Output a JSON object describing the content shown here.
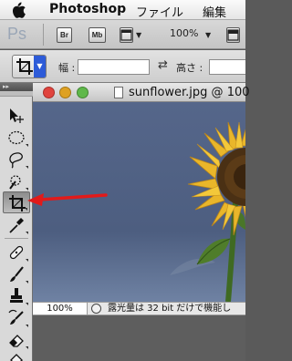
{
  "menubar": {
    "app_name": "Photoshop",
    "menus": [
      "ファイル",
      "編集"
    ]
  },
  "appbar": {
    "logo": "Ps",
    "bridge_label": "Br",
    "minibridge_label": "Mb",
    "zoom_value": "100%"
  },
  "options": {
    "width_label": "幅 :",
    "height_label": "高さ :",
    "width_value": "",
    "height_value": ""
  },
  "tools": [
    {
      "name": "move-tool",
      "icon": "move-icon"
    },
    {
      "name": "marquee-tool",
      "icon": "ellipse-marquee-icon"
    },
    {
      "name": "lasso-tool",
      "icon": "lasso-icon"
    },
    {
      "name": "quick-selection-tool",
      "icon": "quick-selection-icon"
    },
    {
      "name": "crop-tool",
      "icon": "crop-icon",
      "active": true
    },
    {
      "name": "eyedropper-tool",
      "icon": "eyedropper-icon"
    },
    {
      "name": "healing-brush-tool",
      "icon": "bandage-icon"
    },
    {
      "name": "brush-tool",
      "icon": "brush-icon"
    },
    {
      "name": "clone-stamp-tool",
      "icon": "stamp-icon"
    },
    {
      "name": "history-brush-tool",
      "icon": "history-brush-icon"
    },
    {
      "name": "eraser-tool",
      "icon": "eraser-icon"
    },
    {
      "name": "paint-bucket-tool",
      "icon": "paint-bucket-icon"
    }
  ],
  "document": {
    "title": "sunflower.jpg @ 100",
    "status_zoom": "100%",
    "status_info": "露光量は 32 bit だけで機能し"
  },
  "colors": {
    "accent": "#2d5bd8",
    "close": "#e0443e",
    "minimize": "#dea123",
    "zoom": "#5fb84a",
    "annotation_arrow": "#e21a1a"
  }
}
